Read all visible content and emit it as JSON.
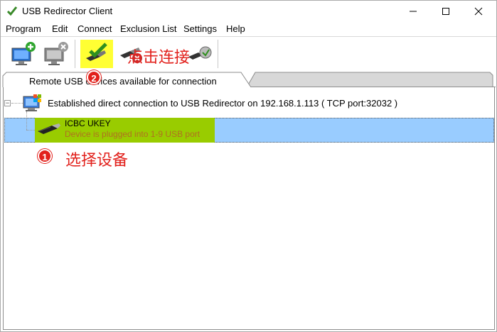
{
  "window": {
    "title": "USB Redirector Client"
  },
  "menu": [
    "Program",
    "Edit",
    "Connect",
    "Exclusion List",
    "Settings",
    "Help"
  ],
  "toolbar": {
    "buttons": [
      "add-server",
      "remove-server",
      "connect-device",
      "disconnect-device",
      "auto-connect"
    ],
    "annotation_label": "点击连接",
    "annotation_number": "2",
    "highlight_color": "#ffff33"
  },
  "tab": {
    "label": "Remote USB devices available for connection"
  },
  "tree": {
    "root_label": "Established direct connection to USB Redirector on 192.168.1.113 ( TCP port:32032 )",
    "device": {
      "name": "ICBC UKEY",
      "status": "Device is plugged into 1-9 USB port"
    },
    "annotation_number": "1",
    "annotation_label": "选择设备"
  },
  "colors": {
    "selection": "#99ccff",
    "device_highlight": "#99cc00",
    "annotation": "#e2211c",
    "status_text": "#b07020"
  }
}
